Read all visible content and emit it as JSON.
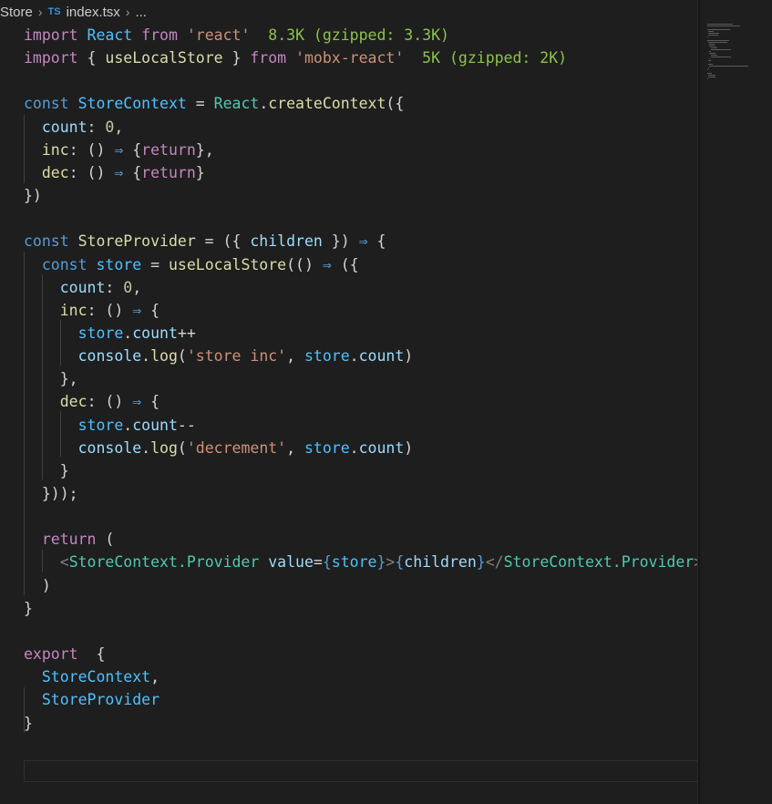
{
  "breadcrumb": {
    "folder": "Store",
    "file_icon": "TS",
    "file": "index.tsx",
    "ellipsis": "..."
  },
  "editor": {
    "language": "typescript",
    "lines": [
      [
        [
          "kw",
          "import"
        ],
        [
          "punc",
          " "
        ],
        [
          "st",
          "React"
        ],
        [
          "punc",
          " "
        ],
        [
          "kw",
          "from"
        ],
        [
          "punc",
          " "
        ],
        [
          "str",
          "'react'"
        ],
        [
          "punc",
          "  "
        ],
        [
          "hint",
          "8.3K (gzipped: 3.3K)"
        ]
      ],
      [
        [
          "kw",
          "import"
        ],
        [
          "punc",
          " { "
        ],
        [
          "fn",
          "useLocalStore"
        ],
        [
          "punc",
          " } "
        ],
        [
          "kw",
          "from"
        ],
        [
          "punc",
          " "
        ],
        [
          "str",
          "'mobx-react'"
        ],
        [
          "punc",
          "  "
        ],
        [
          "hint",
          "5K (gzipped: 2K)"
        ]
      ],
      [],
      [
        [
          "decl",
          "const"
        ],
        [
          "punc",
          " "
        ],
        [
          "st",
          "StoreContext"
        ],
        [
          "punc",
          " = "
        ],
        [
          "cls",
          "React"
        ],
        [
          "punc",
          "."
        ],
        [
          "fn",
          "createContext"
        ],
        [
          "punc",
          "({"
        ]
      ],
      [
        [
          "punc",
          "  "
        ],
        [
          "prop",
          "count"
        ],
        [
          "punc",
          ": "
        ],
        [
          "num",
          "0"
        ],
        [
          "punc",
          ","
        ]
      ],
      [
        [
          "punc",
          "  "
        ],
        [
          "fn",
          "inc"
        ],
        [
          "punc",
          ": () "
        ],
        [
          "arrow",
          "⇒"
        ],
        [
          "punc",
          " {"
        ],
        [
          "kw",
          "return"
        ],
        [
          "punc",
          "},"
        ]
      ],
      [
        [
          "punc",
          "  "
        ],
        [
          "fn",
          "dec"
        ],
        [
          "punc",
          ": () "
        ],
        [
          "arrow",
          "⇒"
        ],
        [
          "punc",
          " {"
        ],
        [
          "kw",
          "return"
        ],
        [
          "punc",
          "}"
        ]
      ],
      [
        [
          "punc",
          "})"
        ]
      ],
      [],
      [
        [
          "decl",
          "const"
        ],
        [
          "punc",
          " "
        ],
        [
          "fn",
          "StoreProvider"
        ],
        [
          "punc",
          " = ({ "
        ],
        [
          "prop",
          "children"
        ],
        [
          "punc",
          " }) "
        ],
        [
          "arrow",
          "⇒"
        ],
        [
          "punc",
          " {"
        ]
      ],
      [
        [
          "punc",
          "  "
        ],
        [
          "decl",
          "const"
        ],
        [
          "punc",
          " "
        ],
        [
          "st",
          "store"
        ],
        [
          "punc",
          " = "
        ],
        [
          "fn",
          "useLocalStore"
        ],
        [
          "punc",
          "(() "
        ],
        [
          "arrow",
          "⇒"
        ],
        [
          "punc",
          " ({"
        ]
      ],
      [
        [
          "punc",
          "    "
        ],
        [
          "prop",
          "count"
        ],
        [
          "punc",
          ": "
        ],
        [
          "num",
          "0"
        ],
        [
          "punc",
          ","
        ]
      ],
      [
        [
          "punc",
          "    "
        ],
        [
          "fn",
          "inc"
        ],
        [
          "punc",
          ": () "
        ],
        [
          "arrow",
          "⇒"
        ],
        [
          "punc",
          " {"
        ]
      ],
      [
        [
          "punc",
          "      "
        ],
        [
          "st",
          "store"
        ],
        [
          "punc",
          "."
        ],
        [
          "prop",
          "count"
        ],
        [
          "punc",
          "++"
        ]
      ],
      [
        [
          "punc",
          "      "
        ],
        [
          "prop",
          "console"
        ],
        [
          "punc",
          "."
        ],
        [
          "fn",
          "log"
        ],
        [
          "punc",
          "("
        ],
        [
          "str",
          "'store inc'"
        ],
        [
          "punc",
          ", "
        ],
        [
          "st",
          "store"
        ],
        [
          "punc",
          "."
        ],
        [
          "prop",
          "count"
        ],
        [
          "punc",
          ")"
        ]
      ],
      [
        [
          "punc",
          "    },"
        ]
      ],
      [
        [
          "punc",
          "    "
        ],
        [
          "fn",
          "dec"
        ],
        [
          "punc",
          ": () "
        ],
        [
          "arrow",
          "⇒"
        ],
        [
          "punc",
          " {"
        ]
      ],
      [
        [
          "punc",
          "      "
        ],
        [
          "st",
          "store"
        ],
        [
          "punc",
          "."
        ],
        [
          "prop",
          "count"
        ],
        [
          "punc",
          "--"
        ]
      ],
      [
        [
          "punc",
          "      "
        ],
        [
          "prop",
          "console"
        ],
        [
          "punc",
          "."
        ],
        [
          "fn",
          "log"
        ],
        [
          "punc",
          "("
        ],
        [
          "str",
          "'decrement'"
        ],
        [
          "punc",
          ", "
        ],
        [
          "st",
          "store"
        ],
        [
          "punc",
          "."
        ],
        [
          "prop",
          "count"
        ],
        [
          "punc",
          ")"
        ]
      ],
      [
        [
          "punc",
          "    }"
        ]
      ],
      [
        [
          "punc",
          "  }));"
        ]
      ],
      [],
      [
        [
          "punc",
          "  "
        ],
        [
          "kw",
          "return"
        ],
        [
          "punc",
          " ("
        ]
      ],
      [
        [
          "punc",
          "    "
        ],
        [
          "tagb",
          "<"
        ],
        [
          "cls",
          "StoreContext.Provider"
        ],
        [
          "punc",
          " "
        ],
        [
          "prop",
          "value"
        ],
        [
          "punc",
          "="
        ],
        [
          "decl",
          "{"
        ],
        [
          "st",
          "store"
        ],
        [
          "decl",
          "}"
        ],
        [
          "tagb",
          ">"
        ],
        [
          "decl",
          "{"
        ],
        [
          "prop",
          "children"
        ],
        [
          "decl",
          "}"
        ],
        [
          "tagb",
          "</"
        ],
        [
          "cls",
          "StoreContext.Provider"
        ],
        [
          "tagb",
          ">"
        ]
      ],
      [
        [
          "punc",
          "  )"
        ]
      ],
      [
        [
          "punc",
          "}"
        ]
      ],
      [],
      [
        [
          "kw",
          "export"
        ],
        [
          "punc",
          "  {"
        ]
      ],
      [
        [
          "punc",
          "  "
        ],
        [
          "st",
          "StoreContext"
        ],
        [
          "punc",
          ","
        ]
      ],
      [
        [
          "punc",
          "  "
        ],
        [
          "st",
          "StoreProvider"
        ]
      ],
      [
        [
          "punc",
          "}"
        ]
      ]
    ]
  },
  "colors": {
    "background": "#1e1e1e",
    "keyword": "#c586c0",
    "declaration": "#569cd6",
    "function": "#dcdcaa",
    "string": "#ce9178",
    "number": "#b5cea8",
    "property": "#9cdcfe",
    "constant": "#4fc1ff",
    "class": "#4ec9b0",
    "import_cost_hint": "#8bc34a"
  }
}
